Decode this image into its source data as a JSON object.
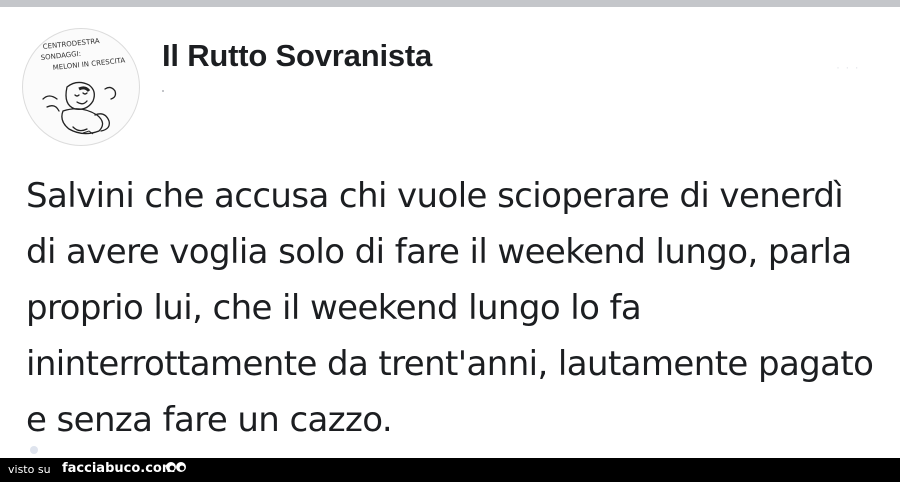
{
  "post": {
    "author": "Il Rutto Sovranista",
    "avatar_caption_lines": [
      "CENTRODESTRA",
      "SONDAGGI:",
      "MELONI IN CRESCITA"
    ],
    "text": "Salvini che accusa chi vuole scioperare di venerdì di avere voglia solo di fare il weekend lungo, parla proprio lui, che il weekend lungo lo fa ininterrottamente da trent'anni, lautamente pagato e senza fare un cazzo."
  },
  "footer": {
    "prefix": "visto su",
    "brand": "facciabuco.com",
    "brand_icon": "eyes-icon"
  },
  "colors": {
    "top_strip": "#c4c6ca",
    "text": "#1c1e21",
    "footer_bg": "#000000",
    "footer_text": "#ffffff"
  }
}
